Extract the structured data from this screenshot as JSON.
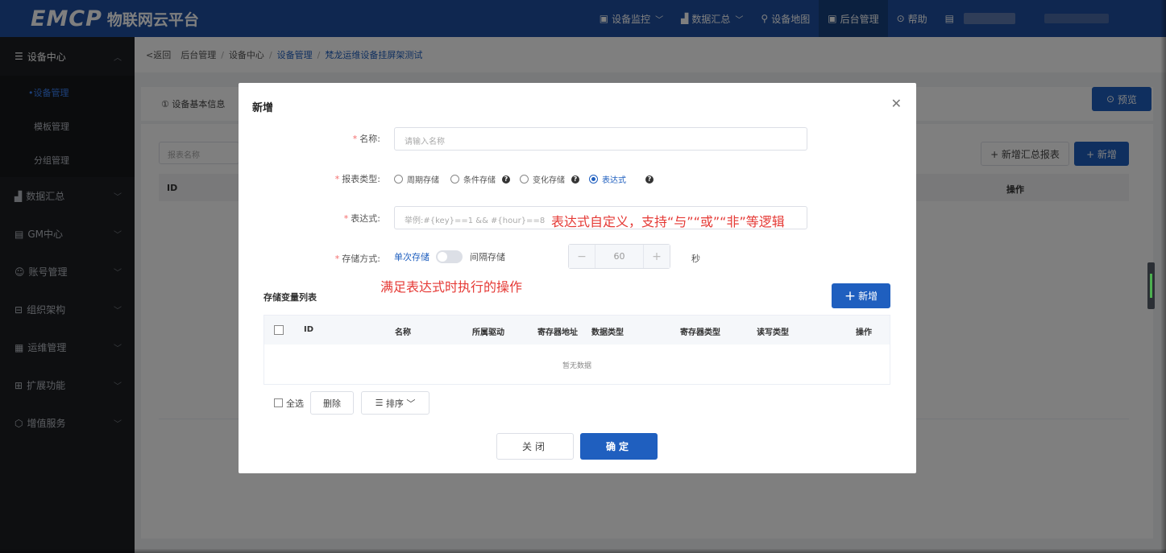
{
  "header": {
    "logo_mark": "EMCP",
    "logo_text": "物联网云平台",
    "nav": [
      {
        "label": "设备监控",
        "icon": "monitor-icon",
        "dropdown": true
      },
      {
        "label": "数据汇总",
        "icon": "chart-icon",
        "dropdown": true
      },
      {
        "label": "设备地图",
        "icon": "map-pin-icon",
        "dropdown": false
      },
      {
        "label": "后台管理",
        "icon": "admin-icon",
        "dropdown": false,
        "active": true
      },
      {
        "label": "帮助",
        "icon": "help-icon",
        "dropdown": false
      }
    ]
  },
  "sidebar": {
    "device_center": "设备中心",
    "sub": [
      "设备管理",
      "模板管理",
      "分组管理"
    ],
    "items": [
      "数据汇总",
      "GM中心",
      "账号管理",
      "组织架构",
      "运维管理",
      "扩展功能",
      "增值服务"
    ]
  },
  "breadcrumb": {
    "back": "返回",
    "path": [
      "后台管理",
      "设备中心",
      "设备管理",
      "梵龙运维设备挂屏架测试"
    ]
  },
  "background": {
    "tab_basic": "① 设备基本信息",
    "preview": "预览",
    "search_placeholder": "报表名称",
    "add_summary": "+ 新增汇总报表",
    "add": "+ 新增",
    "col_id": "ID",
    "col_action": "操作"
  },
  "dialog": {
    "title": "新增",
    "name_label": "名称:",
    "name_placeholder": "请输入名称",
    "type_label": "报表类型:",
    "types": [
      "周期存储",
      "条件存储",
      "变化存储",
      "表达式"
    ],
    "selected_type": "表达式",
    "expr_label": "表达式:",
    "expr_placeholder": "举例:#{key}==1 && #{hour}==8",
    "store_label": "存储方式:",
    "store_single": "单次存储",
    "store_interval": "间隔存储",
    "interval_value": "60",
    "interval_unit": "秒",
    "list_title": "存储变量列表",
    "add_button": "新增",
    "columns": [
      "ID",
      "名称",
      "所属驱动",
      "寄存器地址",
      "数据类型",
      "寄存器类型",
      "读写类型",
      "操作"
    ],
    "empty_text": "暂无数据",
    "select_all": "全选",
    "delete": "删除",
    "sort": "排序",
    "close_button": "关闭",
    "confirm_button": "确定"
  },
  "annotations": {
    "expr_note": "表达式自定义，支持“与”“或”“非”等逻辑",
    "action_note": "满足表达式时执行的操作"
  }
}
